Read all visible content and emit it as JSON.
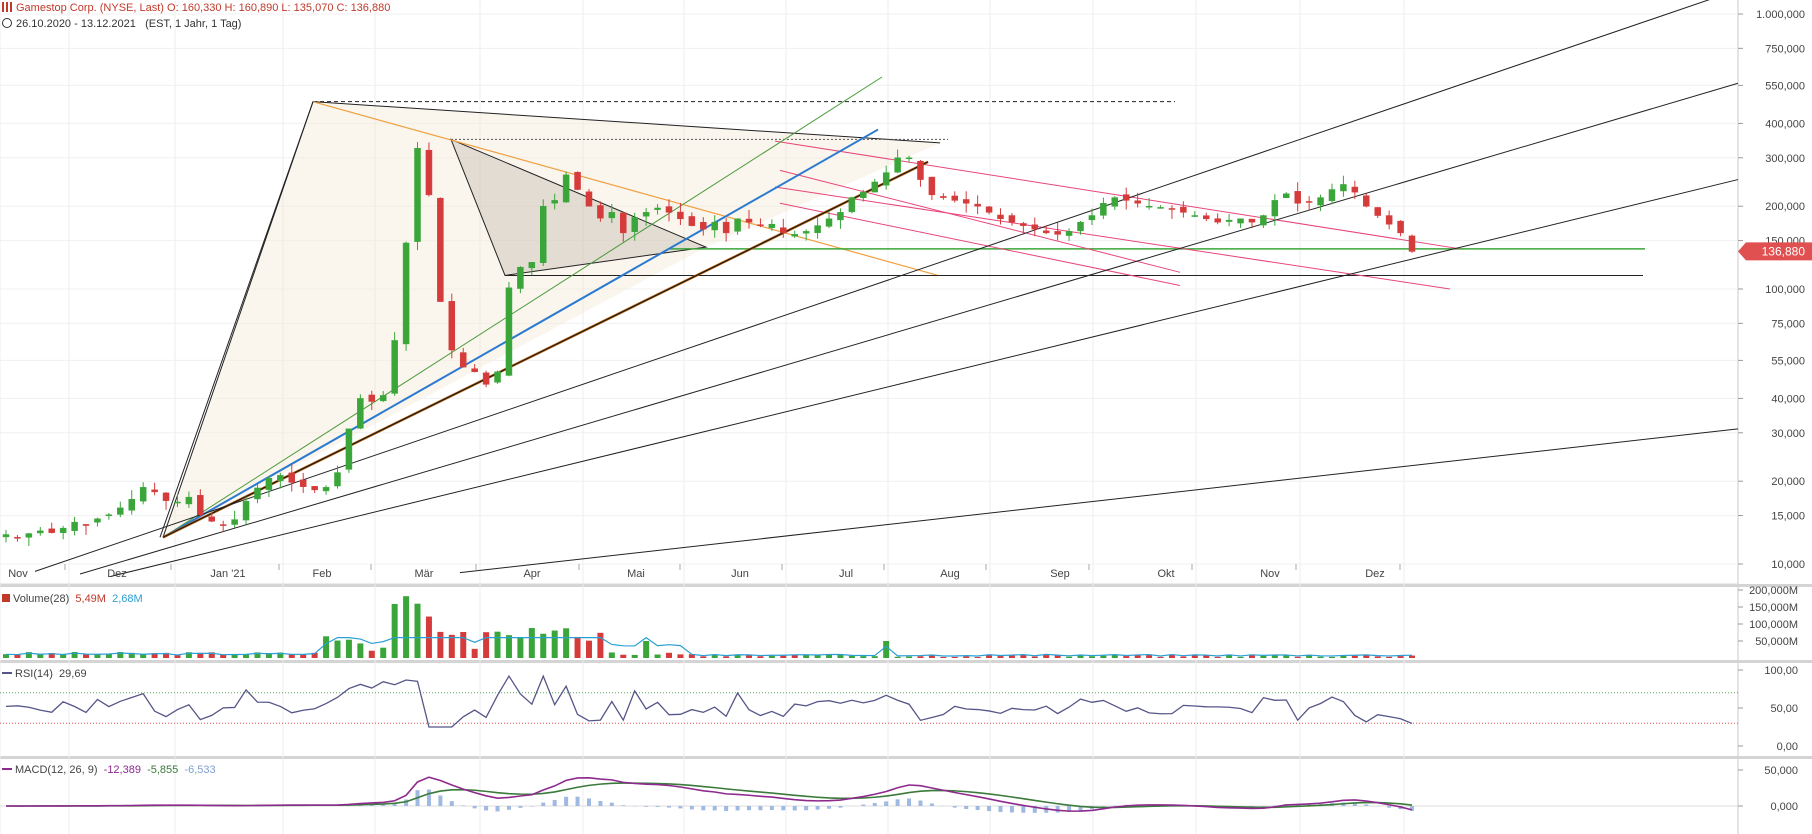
{
  "header": {
    "title_line": "Gamestop Corp. (NYSE, Last)",
    "ohlc": {
      "open_label": "O:",
      "open": "160,330",
      "high_label": "H:",
      "high": "160,890",
      "low_label": "L:",
      "low": "135,070",
      "close_label": "C:",
      "close": "136,880"
    },
    "period": "26.10.2020 - 13.12.2021",
    "settings": "(EST, 1 Jahr, 1 Tag)"
  },
  "colors": {
    "up": "#3aa63a",
    "down": "#d63b3b",
    "current": "#e05050",
    "volume_avg": "#2a9fd6",
    "rsi": "#555588",
    "macd": "#8e2a8e",
    "signal": "#3a7a3a",
    "hist": "#9fb9e0",
    "pink": "#e8457a",
    "hline_green": "#3aa63a"
  },
  "chart_data": {
    "type": "candlestick",
    "title": "Gamestop Corp. (NYSE, Last)",
    "y_scale": "log",
    "y_ticks": [
      "1.000,000",
      "750,000",
      "550,000",
      "400,000",
      "300,000",
      "200,000",
      "150,000",
      "100,000",
      "75,000",
      "55,000",
      "40,000",
      "30,000",
      "20,000",
      "15,000",
      "10,000"
    ],
    "y_tick_values": [
      1000,
      750,
      550,
      400,
      300,
      200,
      150,
      100,
      75,
      55,
      40,
      30,
      20,
      15,
      10
    ],
    "x_labels": [
      "Nov",
      "Dez",
      "Jan '21",
      "Feb",
      "Mär",
      "Apr",
      "Mai",
      "Jun",
      "Jul",
      "Aug",
      "Sep",
      "Okt",
      "Nov",
      "Dez"
    ],
    "last_price": "136,880",
    "close_series": [
      12.8,
      12.5,
      12.9,
      13.2,
      13.0,
      13.5,
      14.2,
      13.8,
      14.6,
      15.1,
      16.0,
      17.2,
      19.0,
      18.3,
      17.0,
      16.8,
      17.5,
      15.1,
      14.3,
      13.8,
      14.5,
      16.9,
      18.9,
      20.5,
      21.0,
      19.8,
      19.1,
      18.6,
      19.0,
      21.5,
      31.0,
      40.0,
      39.0,
      41.0,
      65.0,
      147.0,
      325.0,
      220.0,
      90.0,
      60.0,
      52.0,
      50.0,
      45.0,
      50.0,
      101.0,
      120.0,
      125.0,
      200.0,
      210.0,
      260.0,
      230.0,
      200.0,
      181.0,
      190.0,
      160.0,
      182.0,
      190.0,
      197.0,
      190.0,
      180.0,
      170.0,
      165.0,
      175.0,
      160.0,
      180.0,
      175.0,
      170.0,
      172.0,
      160.0,
      158.0,
      162.0,
      170.0,
      180.0,
      190.0,
      215.0,
      225.0,
      245.0,
      265.0,
      300.0,
      300.0,
      250.0,
      220.0,
      215.0,
      210.0,
      205.0,
      200.0,
      190.0,
      180.0,
      175.0,
      170.0,
      165.0,
      160.0,
      158.0,
      162.0,
      175.0,
      185.0,
      205.0,
      215.0,
      210.0,
      205.0,
      200.0,
      198.0,
      195.0,
      190.0,
      185.0,
      180.0,
      175.0,
      178.0,
      180.0,
      175.0,
      185.0,
      210.0,
      222.0,
      205.0,
      208.0,
      215.0,
      230.0,
      240.0,
      225.0,
      200.0,
      185.0,
      172.0,
      160.0,
      137.0
    ],
    "volume": {
      "label": "Volume(28)",
      "last": "5,49M",
      "avg": "2,68M",
      "y_ticks": [
        "200,000M",
        "150,000M",
        "100,000M",
        "50,000M"
      ]
    },
    "rsi": {
      "label": "RSI(14)",
      "value": "29,69",
      "y_ticks": [
        "100,00",
        "50,00",
        "0,00"
      ],
      "upper": 70,
      "lower": 30
    },
    "macd": {
      "label": "MACD(12, 26, 9)",
      "value": "-12,389",
      "signal": "-5,855",
      "hist": "-6,533",
      "y_ticks": [
        "50,000",
        "0,000"
      ]
    }
  }
}
